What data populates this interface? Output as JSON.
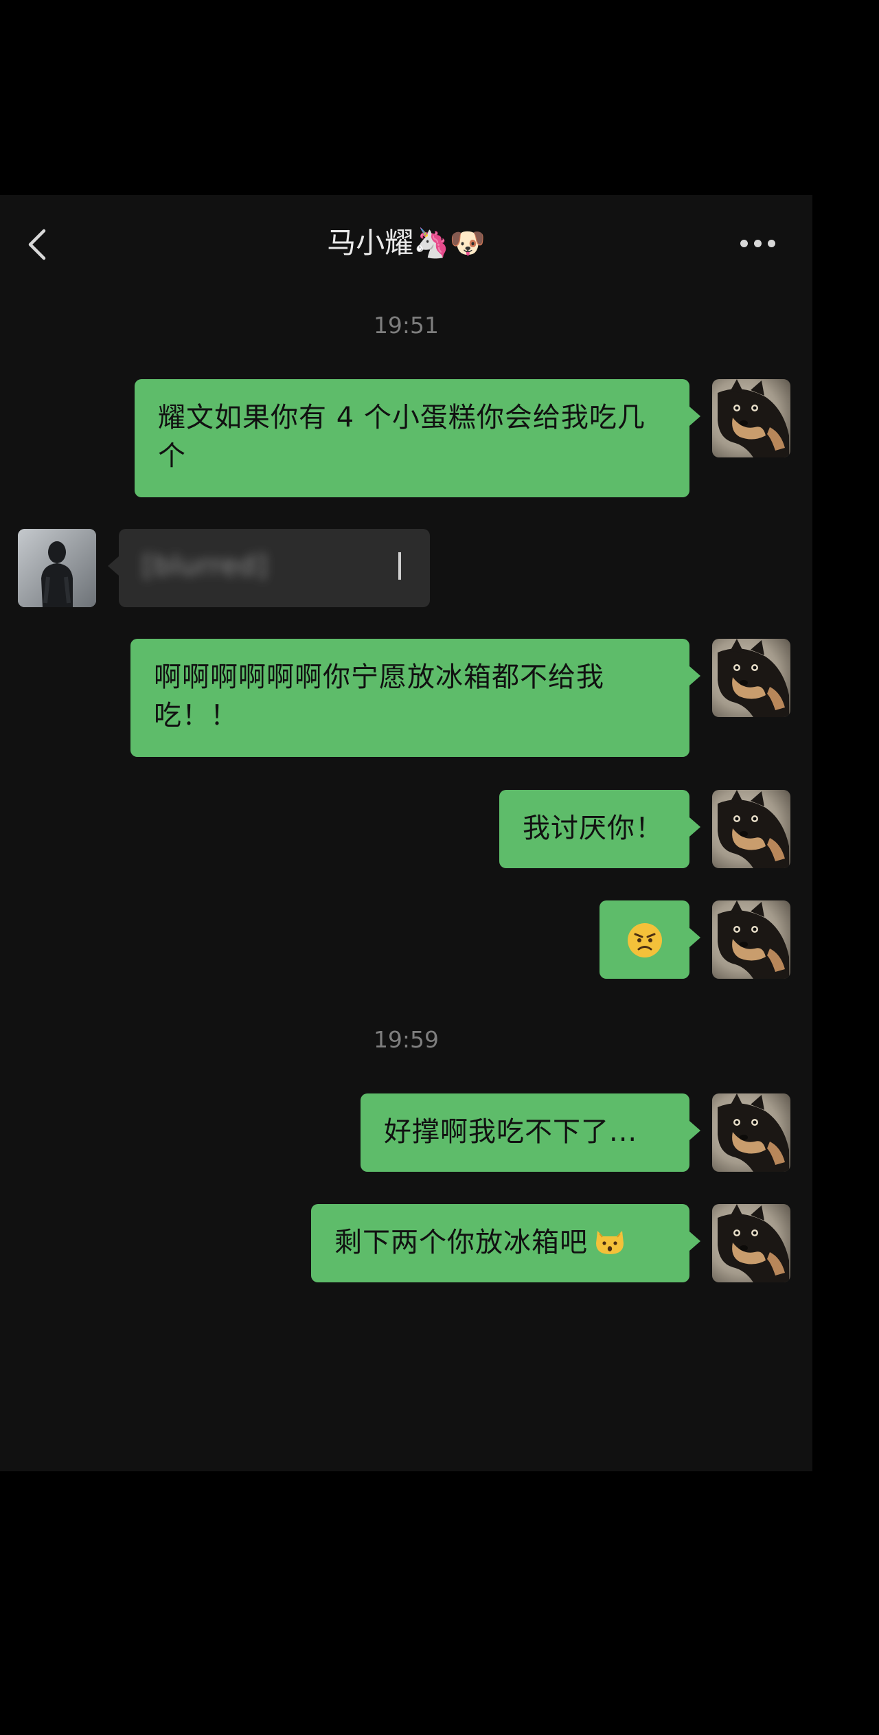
{
  "header": {
    "back_icon": "chevron-left-icon",
    "title": "马小耀🦄🐶",
    "more_icon": "more-dots-icon"
  },
  "colors": {
    "screen_background": "#111111",
    "my_bubble": "#5ebc6a",
    "their_bubble": "#2c2c2c",
    "timestamp_text": "#7e7e7e",
    "title_text": "#e9e9e9"
  },
  "messages": [
    {
      "type": "timestamp",
      "text": "19:51"
    },
    {
      "type": "message",
      "sender": "me",
      "avatar_icon": "shiba-dog-avatar-icon",
      "text": "耀文如果你有 4 个小蛋糕你会给我吃几个"
    },
    {
      "type": "message",
      "sender": "other",
      "avatar_icon": "silhouette-avatar-icon",
      "text": "[blurred]"
    },
    {
      "type": "message",
      "sender": "me",
      "avatar_icon": "shiba-dog-avatar-icon",
      "text": "啊啊啊啊啊啊你宁愿放冰箱都不给我吃！！"
    },
    {
      "type": "message",
      "sender": "me",
      "avatar_icon": "shiba-dog-avatar-icon",
      "text": "我讨厌你！"
    },
    {
      "type": "message",
      "sender": "me",
      "avatar_icon": "shiba-dog-avatar-icon",
      "emoji": "angry-face-icon"
    },
    {
      "type": "timestamp",
      "text": "19:59"
    },
    {
      "type": "message",
      "sender": "me",
      "avatar_icon": "shiba-dog-avatar-icon",
      "text": "好撑啊我吃不下了..."
    },
    {
      "type": "message",
      "sender": "me",
      "avatar_icon": "shiba-dog-avatar-icon",
      "text": "剩下两个你放冰箱吧",
      "emoji": "cat-face-icon"
    }
  ]
}
